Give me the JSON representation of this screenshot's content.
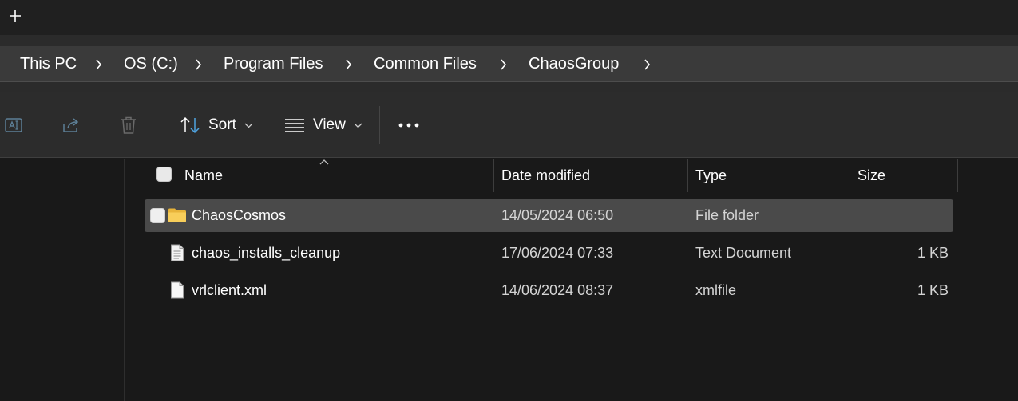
{
  "tabstrip": {
    "new_tab_icon": "plus-icon"
  },
  "breadcrumb": {
    "items": [
      "This PC",
      "OS (C:)",
      "Program Files",
      "Common Files",
      "ChaosGroup"
    ]
  },
  "commandbar": {
    "rename_icon": "rename-icon",
    "share_icon": "share-icon",
    "delete_icon": "trash-icon",
    "sort_label": "Sort",
    "view_label": "View",
    "more_icon": "more-horizontal-icon"
  },
  "columns": {
    "name": "Name",
    "date_modified": "Date modified",
    "type": "Type",
    "size": "Size",
    "sort_column": "Name",
    "sort_direction": "ascending"
  },
  "files": [
    {
      "name": "ChaosCosmos",
      "date": "14/05/2024 06:50",
      "type": "File folder",
      "size": "",
      "icon": "folder-icon",
      "selected": true
    },
    {
      "name": "chaos_installs_cleanup",
      "date": "17/06/2024 07:33",
      "type": "Text Document",
      "size": "1 KB",
      "icon": "text-document-icon",
      "selected": false
    },
    {
      "name": "vrlclient.xml",
      "date": "14/06/2024 08:37",
      "type": "xmlfile",
      "size": "1 KB",
      "icon": "xml-file-icon",
      "selected": false
    }
  ],
  "colors": {
    "background": "#191919",
    "selection": "#4a4a4a",
    "folder": "#f4c542"
  }
}
